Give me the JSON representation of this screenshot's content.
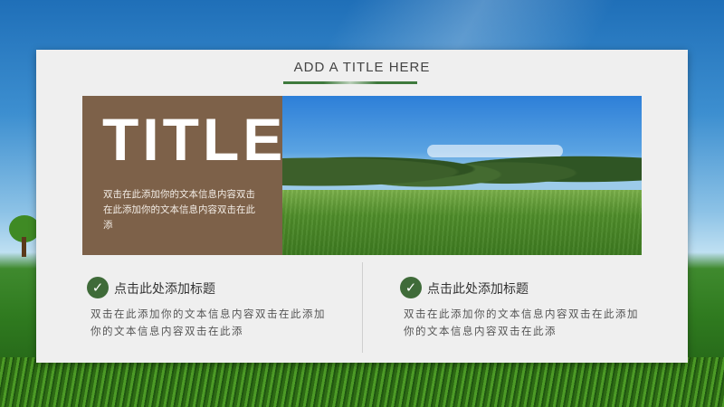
{
  "header": {
    "title": "ADD A TITLE HERE"
  },
  "banner": {
    "big_title": "TITLE",
    "description": "双击在此添加你的文本信息内容双击在此添加你的文本信息内容双击在此添"
  },
  "features": [
    {
      "title": "点击此处添加标题",
      "description": "双击在此添加你的文本信息内容双击在此添加你的文本信息内容双击在此添"
    },
    {
      "title": "点击此处添加标题",
      "description": "双击在此添加你的文本信息内容双击在此添加你的文本信息内容双击在此添"
    }
  ],
  "icons": {
    "check": "checkmark-icon"
  },
  "colors": {
    "accent_green": "#3f6b39",
    "panel_brown": "#7d6149"
  }
}
